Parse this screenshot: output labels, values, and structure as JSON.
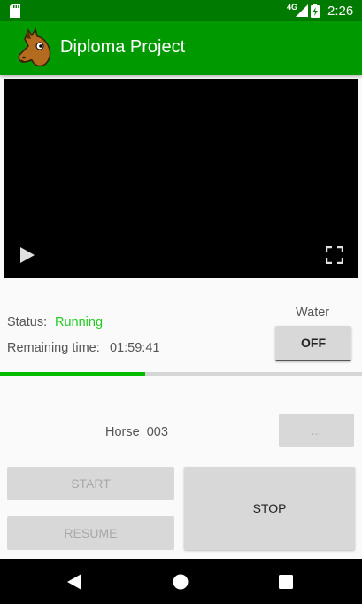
{
  "status_bar": {
    "network": "4G",
    "time": "2:26"
  },
  "app_bar": {
    "title": "Diploma Project",
    "logo_icon": "horse-head-icon"
  },
  "video": {
    "play_icon": "play-icon",
    "fullscreen_icon": "fullscreen-icon"
  },
  "status": {
    "label": "Status:",
    "value": "Running",
    "value_color": "#22cc22"
  },
  "remaining": {
    "label": "Remaining time:",
    "value": "01:59:41"
  },
  "water": {
    "label": "Water",
    "toggle_label": "OFF"
  },
  "progress": {
    "fraction": 0.4
  },
  "horse": {
    "name": "Horse_003",
    "more_label": "..."
  },
  "controls": {
    "start_label": "START",
    "resume_label": "RESUME",
    "stop_label": "STOP"
  },
  "colors": {
    "app_bar": "#009900",
    "status_bar": "#007a00",
    "accent": "#00bb00"
  }
}
